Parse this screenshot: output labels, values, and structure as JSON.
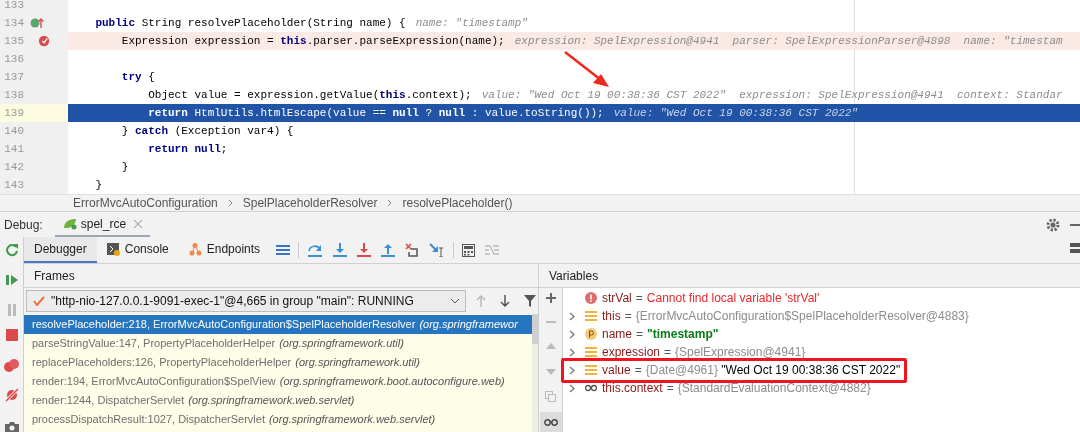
{
  "editor": {
    "lines": [
      {
        "number": "133",
        "kind": "plain"
      },
      {
        "number": "134",
        "kind": "override",
        "segments": [
          {
            "text": "    public ",
            "kind": "keyword"
          },
          {
            "text": "String resolvePlaceholder(String name) {",
            "kind": "plain"
          }
        ],
        "hint": "name: \"timestamp\""
      },
      {
        "number": "135",
        "kind": "breakpoint",
        "breakpoint": true,
        "segments": [
          {
            "text": "        Expression expression = ",
            "kind": "plain"
          },
          {
            "text": "this",
            "kind": "keyword"
          },
          {
            "text": ".parser.parseExpression(name);",
            "kind": "plain"
          }
        ],
        "hint": "expression: SpelExpression@4941  parser: SpelExpressionParser@4898  name: \"timestam"
      },
      {
        "number": "136",
        "kind": "plain"
      },
      {
        "number": "137",
        "kind": "plain",
        "segments": [
          {
            "text": "        try",
            "kind": "keyword"
          },
          {
            "text": " {",
            "kind": "plain"
          }
        ]
      },
      {
        "number": "138",
        "kind": "plain",
        "segments": [
          {
            "text": "            Object value = expression.getValue(",
            "kind": "plain"
          },
          {
            "text": "this",
            "kind": "keyword"
          },
          {
            "text": ".context);",
            "kind": "plain"
          }
        ],
        "hint": "value: \"Wed Oct 19 00:38:36 CST 2022\"  expression: SpelExpression@4941  context: Standar"
      },
      {
        "number": "139",
        "kind": "bulb",
        "current": true,
        "segments": [
          {
            "text": "            return",
            "kind": "keyword"
          },
          {
            "text": " HtmlUtils.htmlEscape(value == ",
            "kind": "plain"
          },
          {
            "text": "null",
            "kind": "keyword"
          },
          {
            "text": " ? ",
            "kind": "plain"
          },
          {
            "text": "null",
            "kind": "keyword"
          },
          {
            "text": " : value.toString());",
            "kind": "plain"
          }
        ],
        "hint": "value: \"Wed Oct 19 00:38:36 CST 2022\""
      },
      {
        "number": "140",
        "kind": "plain",
        "segments": [
          {
            "text": "        } ",
            "kind": "plain"
          },
          {
            "text": "catch",
            "kind": "keyword"
          },
          {
            "text": " (Exception var4) {",
            "kind": "plain"
          }
        ]
      },
      {
        "number": "141",
        "kind": "plain",
        "segments": [
          {
            "text": "            return null",
            "kind": "keyword"
          },
          {
            "text": ";",
            "kind": "plain"
          }
        ]
      },
      {
        "number": "142",
        "kind": "plain",
        "segments": [
          {
            "text": "        }",
            "kind": "plain"
          }
        ]
      },
      {
        "number": "143",
        "kind": "plain",
        "segments": [
          {
            "text": "    }",
            "kind": "plain"
          }
        ]
      }
    ]
  },
  "breadcrumbs": [
    "ErrorMvcAutoConfiguration",
    "SpelPlaceholderResolver",
    "resolvePlaceholder()"
  ],
  "debug": {
    "label": "Debug:",
    "session_tab": "spel_rce",
    "tabs": [
      {
        "label": "Debugger",
        "selected": true
      },
      {
        "label": "Console",
        "selected": false
      },
      {
        "label": "Endpoints",
        "selected": false
      }
    ],
    "frames": {
      "title": "Frames",
      "thread": "\"http-nio-127.0.0.1-9091-exec-1\"@4,665 in group \"main\": RUNNING",
      "items": [
        {
          "method": "resolvePlaceholder:218, ErrorMvcAutoConfiguration$SpelPlaceholderResolver",
          "package": "(org.springframewor",
          "selected": true
        },
        {
          "method": "parseStringValue:147, PropertyPlaceholderHelper",
          "package": "(org.springframework.util)",
          "selected": false
        },
        {
          "method": "replacePlaceholders:126, PropertyPlaceholderHelper",
          "package": "(org.springframework.util)",
          "selected": false
        },
        {
          "method": "render:194, ErrorMvcAutoConfiguration$SpelView",
          "package": "(org.springframework.boot.autoconfigure.web)",
          "selected": false
        },
        {
          "method": "render:1244, DispatcherServlet",
          "package": "(org.springframework.web.servlet)",
          "selected": false
        },
        {
          "method": "processDispatchResult:1027, DispatcherServlet",
          "package": "(org.springframework.web.servlet)",
          "selected": false
        }
      ]
    },
    "variables": {
      "title": "Variables",
      "items": [
        {
          "kind": "error",
          "name": "strVal",
          "separator": "=",
          "value": [
            {
              "text": "Cannot find local variable 'strVal'",
              "kind": "error"
            }
          ]
        },
        {
          "kind": "field",
          "name": "this",
          "separator": "=",
          "value": [
            {
              "text": "{ErrorMvcAutoConfiguration$SpelPlaceholderResolver@4883}",
              "kind": "type"
            }
          ]
        },
        {
          "kind": "param",
          "name": "name",
          "separator": "=",
          "value": [
            {
              "text": "\"timestamp\"",
              "kind": "string"
            }
          ]
        },
        {
          "kind": "field",
          "name": "expression",
          "separator": "=",
          "value": [
            {
              "text": "{SpelExpression@4941}",
              "kind": "type"
            }
          ]
        },
        {
          "kind": "field",
          "name": "value",
          "separator": "=",
          "highlighted": true,
          "value": [
            {
              "text": "{Date@4961}",
              "kind": "type"
            },
            {
              "text": "\"Wed Oct 19 00:38:36 CST 2022\"",
              "kind": "plain"
            }
          ]
        },
        {
          "kind": "watch",
          "name": "this.context",
          "separator": "=",
          "value": [
            {
              "text": "{StandardEvaluationContext@4882}",
              "kind": "type"
            }
          ]
        }
      ]
    }
  }
}
